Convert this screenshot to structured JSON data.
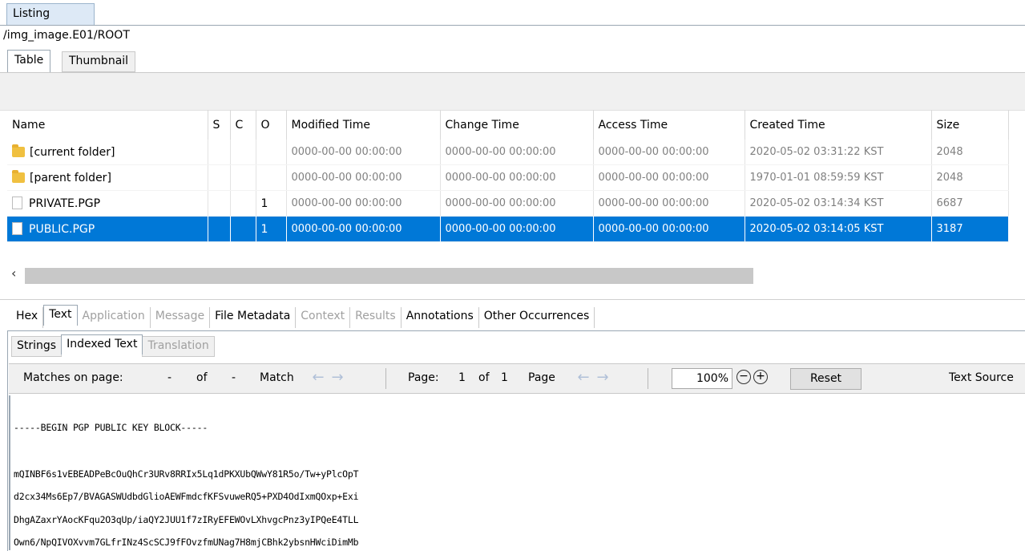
{
  "panel_tab": "Listing",
  "path": "/img_image.E01/ROOT",
  "view_tabs": [
    "Table",
    "Thumbnail"
  ],
  "columns": [
    "Name",
    "S",
    "C",
    "O",
    "Modified Time",
    "Change Time",
    "Access Time",
    "Created Time",
    "Size"
  ],
  "rows": [
    {
      "icon": "folder-icon",
      "name": "[current folder]",
      "s": "",
      "c": "",
      "o": "",
      "modified": "0000-00-00 00:00:00",
      "change": "0000-00-00 00:00:00",
      "access": "0000-00-00 00:00:00",
      "created": "2020-05-02 03:31:22 KST",
      "size": "2048"
    },
    {
      "icon": "folder-icon",
      "name": "[parent folder]",
      "s": "",
      "c": "",
      "o": "",
      "modified": "0000-00-00 00:00:00",
      "change": "0000-00-00 00:00:00",
      "access": "0000-00-00 00:00:00",
      "created": "1970-01-01 08:59:59 KST",
      "size": "2048"
    },
    {
      "icon": "file-icon",
      "name": "PRIVATE.PGP",
      "s": "",
      "c": "",
      "o": "1",
      "modified": "0000-00-00 00:00:00",
      "change": "0000-00-00 00:00:00",
      "access": "0000-00-00 00:00:00",
      "created": "2020-05-02 03:14:34 KST",
      "size": "6687"
    },
    {
      "icon": "file-icon",
      "name": "PUBLIC.PGP",
      "s": "",
      "c": "",
      "o": "1",
      "modified": "0000-00-00 00:00:00",
      "change": "0000-00-00 00:00:00",
      "access": "0000-00-00 00:00:00",
      "created": "2020-05-02 03:14:05 KST",
      "size": "3187"
    }
  ],
  "content_tabs": [
    "Hex",
    "Text",
    "Application",
    "Message",
    "File Metadata",
    "Context",
    "Results",
    "Annotations",
    "Other Occurrences"
  ],
  "text_subtabs": [
    "Strings",
    "Indexed Text",
    "Translation"
  ],
  "toolbar": {
    "matches_label": "Matches on page:",
    "matches_cur": "-",
    "of1": "of",
    "matches_total": "-",
    "match_label": "Match",
    "page_label": "Page:",
    "page_cur": "1",
    "of2": "of",
    "page_total": "1",
    "page_nav_label": "Page",
    "zoom": "100%",
    "reset": "Reset",
    "text_source": "Text Source"
  },
  "text_lines": [
    "-----BEGIN PGP PUBLIC KEY BLOCK-----",
    "",
    "mQINBF6s1vEBEADPeBcOuQhCr3URv8RRIx5Lq1dPKXUbQWwY81R5o/Tw+yPlcOpT",
    "d2cx34Ms6Ep7/BVAGASWUdbdGlioAEWFmdcfKFSvuweRQ5+PXD4OdIxmQOxp+Exi",
    "DhgAZaxrYAocKFqu2O3qUp/iaQY2JUU1f7zIRyEFEWOvLXhvgcPnz3yIPQeE4TLL",
    "Own6/NpQIVOXvvm7GLfrINz4ScSCJ9fFOvzfmUNag7H8mjCBhk2ybsnHWciDimMb"
  ]
}
